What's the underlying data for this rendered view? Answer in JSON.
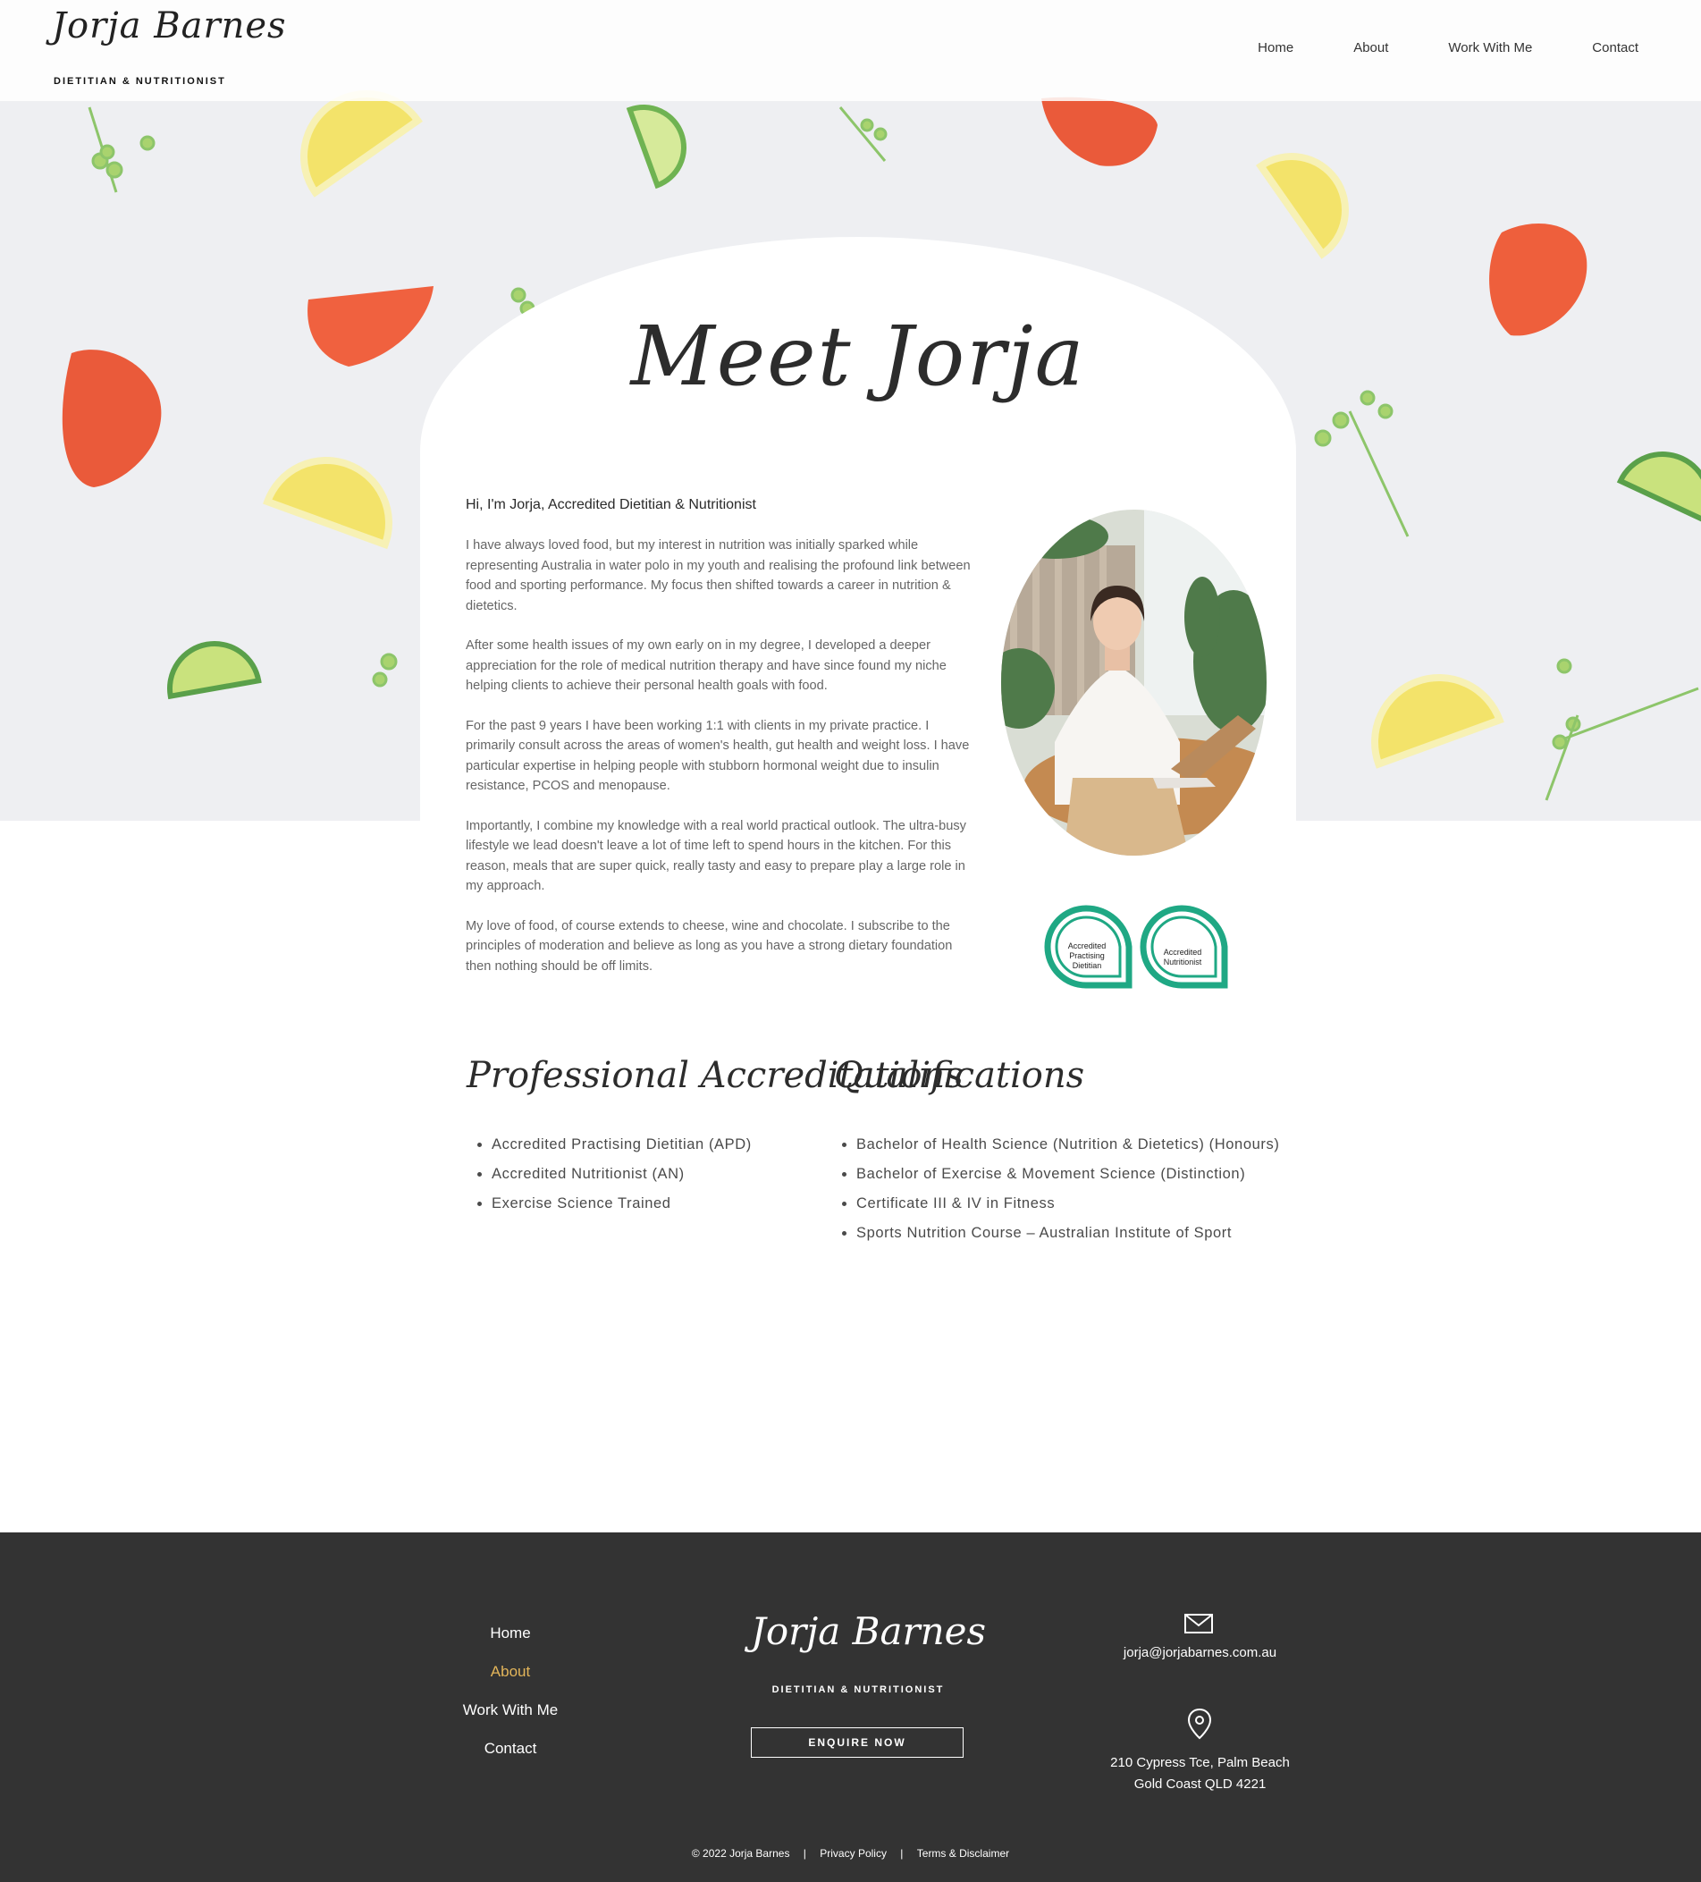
{
  "header": {
    "logo_script": "Jorja Barnes",
    "logo_subtitle": "DIETITIAN & NUTRITIONIST",
    "nav": [
      "Home",
      "About",
      "Work With Me",
      "Contact"
    ]
  },
  "main": {
    "title": "Meet Jorja",
    "intro_heading": "Hi, I'm Jorja, Accredited Dietitian & Nutritionist",
    "paragraphs": [
      "I have always loved food, but my interest in nutrition was initially sparked while representing Australia in water polo in my youth and realising the profound link between food and sporting performance. My focus then shifted towards a career in nutrition & dietetics.",
      "After some health issues of my own early on in my degree, I developed a deeper appreciation for the role of medical nutrition therapy and have since found my niche helping clients to achieve their personal health goals with food.",
      "For the past 9 years I have been working 1:1 with clients in my private practice. I primarily consult across the areas of women's health, gut health and weight loss. I have particular expertise in helping people with stubborn hormonal weight due to insulin resistance, PCOS and menopause.",
      "Importantly, I combine my knowledge with a real world practical outlook. The ultra-busy lifestyle we lead doesn't leave a lot of time left to spend hours in the kitchen. For this reason, meals that are super quick, really tasty and easy to prepare play a large role in my approach.",
      "My love of food, of course extends to cheese, wine and chocolate.  I subscribe to the principles of moderation and believe as long as you have a strong dietary foundation then nothing should be off limits."
    ],
    "badges": {
      "apd": [
        "Accredited",
        "Practising",
        "Dietitian"
      ],
      "an": [
        "Accredited",
        "Nutritionist"
      ],
      "color": "#1fa884"
    },
    "accreditations": {
      "title": "Professional Accreditations",
      "items": [
        "Accredited Practising Dietitian (APD)",
        "Accredited Nutritionist (AN)",
        "Exercise Science Trained"
      ]
    },
    "qualifications": {
      "title": "Qualifications",
      "items": [
        "Bachelor of Health Science (Nutrition & Dietetics) (Honours)",
        "Bachelor of Exercise & Movement Science (Distinction)",
        "Certificate III & IV in Fitness",
        "Sports Nutrition Course – Australian Institute of Sport"
      ]
    }
  },
  "footer": {
    "nav": [
      "Home",
      "About",
      "Work With Me",
      "Contact"
    ],
    "active_nav": "About",
    "logo_script": "Jorja Barnes",
    "logo_subtitle": "DIETITIAN & NUTRITIONIST",
    "cta": "ENQUIRE NOW",
    "email": "jorja@jorjabarnes.com.au",
    "address_line1": "210 Cypress Tce, Palm Beach",
    "address_line2": "Gold Coast QLD 4221",
    "copyright": "© 2022 Jorja Barnes",
    "privacy": "Privacy Policy",
    "terms": "Terms & Disclaimer",
    "background": "#333333",
    "accent": "#e3b55a"
  }
}
